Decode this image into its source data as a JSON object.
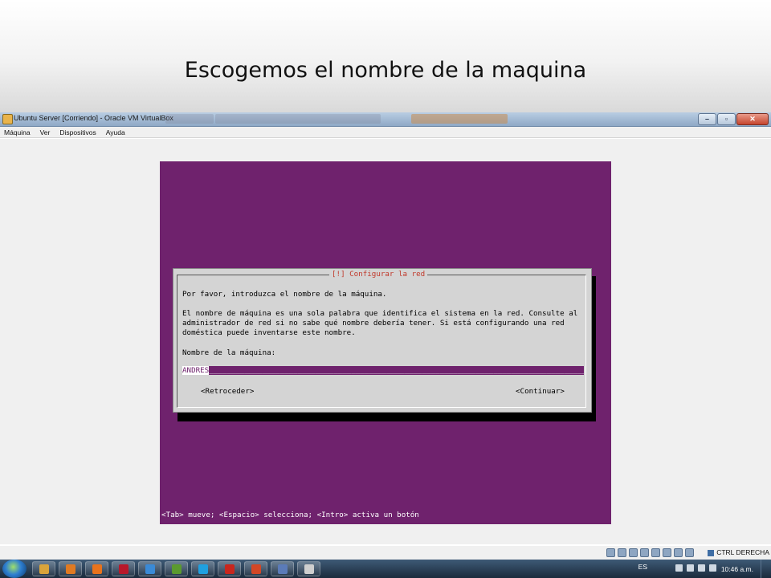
{
  "slide": {
    "title": "Escogemos el nombre de la maquina"
  },
  "window": {
    "title": "Ubuntu Server [Corriendo] - Oracle VM VirtualBox",
    "controls": [
      "minimize-icon",
      "maximize-icon",
      "close-icon"
    ]
  },
  "menubar": {
    "items": [
      {
        "label": "Máquina"
      },
      {
        "label": "Ver"
      },
      {
        "label": "Dispositivos"
      },
      {
        "label": "Ayuda"
      }
    ]
  },
  "installer": {
    "dialog_title": "[!] Configurar la red",
    "prompt": "Por favor, introduzca el nombre de la máquina.",
    "description": [
      "El nombre de máquina es una sola palabra que identifica el sistema en la red. Consulte al",
      "administrador de red si no sabe qué nombre debería tener. Si está configurando una red",
      "doméstica puede inventarse este nombre."
    ],
    "field_label": "Nombre de la máquina:",
    "hostname_value": "ANDRES",
    "back_button": "<Retroceder>",
    "continue_button": "<Continuar>",
    "help_line": "<Tab> mueve; <Espacio> selecciona; <Intro> activa un botón"
  },
  "vbox_status": {
    "host_key": "CTRL DERECHA",
    "icons": [
      "hard-disk-icon",
      "cd-icon",
      "usb-icon",
      "network-icon",
      "shared-folder-icon",
      "display-icon",
      "capture-icon",
      "virtualization-icon"
    ]
  },
  "taskbar": {
    "apps": [
      {
        "name": "explorer-icon",
        "color": "#d9a43a"
      },
      {
        "name": "media-player-icon",
        "color": "#e07a22"
      },
      {
        "name": "firefox-icon",
        "color": "#e8731c"
      },
      {
        "name": "flash-icon",
        "color": "#b8182a"
      },
      {
        "name": "internet-explorer-icon",
        "color": "#3a8ad6"
      },
      {
        "name": "dreamweaver-icon",
        "color": "#5b9a2f"
      },
      {
        "name": "skype-icon",
        "color": "#1fa0e0"
      },
      {
        "name": "acrobat-icon",
        "color": "#c8261d"
      },
      {
        "name": "powerpoint-icon",
        "color": "#d24726"
      },
      {
        "name": "virtualbox-icon",
        "color": "#5b7bb8"
      },
      {
        "name": "chrome-icon",
        "color": "#cfcfcf"
      }
    ],
    "language": "ES",
    "clock": "10:46 a.m."
  }
}
